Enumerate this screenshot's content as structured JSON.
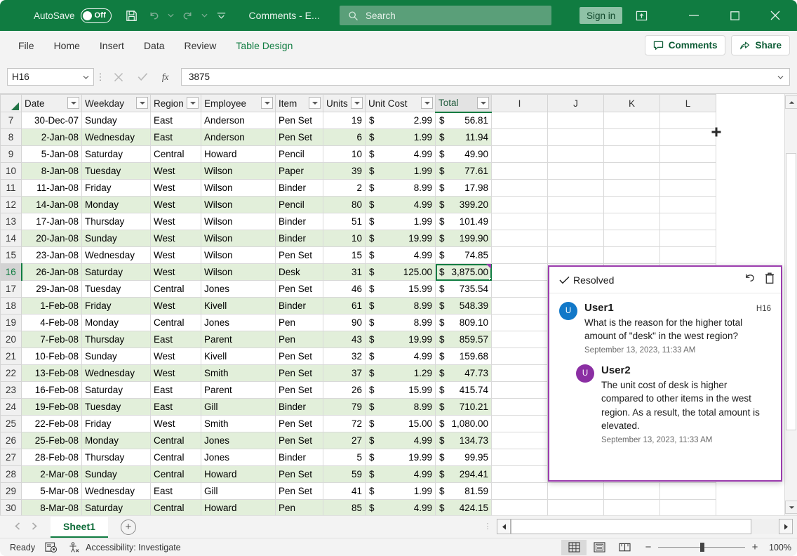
{
  "titlebar": {
    "autosave_label": "AutoSave",
    "autosave_state": "Off",
    "document_title": "Comments  -  E...",
    "sign_in": "Sign in",
    "icons": {
      "save": "save-icon",
      "undo": "undo-icon",
      "redo": "redo-icon",
      "customize": "customize-quick-access-toolbar-icon",
      "ribbon_display": "ribbon-display-options-icon",
      "minimize": "minimize-icon",
      "maximize": "maximize-icon",
      "close": "close-icon"
    }
  },
  "search": {
    "placeholder": "Search"
  },
  "ribbon": {
    "tabs": [
      {
        "label": "File",
        "active": false,
        "contextual": false
      },
      {
        "label": "Home",
        "active": false,
        "contextual": false
      },
      {
        "label": "Insert",
        "active": false,
        "contextual": false
      },
      {
        "label": "Data",
        "active": false,
        "contextual": false
      },
      {
        "label": "Review",
        "active": false,
        "contextual": false
      },
      {
        "label": "Table Design",
        "active": true,
        "contextual": true
      }
    ],
    "comments_button": "Comments",
    "share_button": "Share"
  },
  "formula_bar": {
    "name_box": "H16",
    "value": "3875",
    "cancel_icon": "cancel-icon",
    "enter_icon": "enter-icon",
    "fx_icon": "insert-function-icon",
    "expand_icon": "expand-formula-bar-icon"
  },
  "grid": {
    "column_letters": [
      "I",
      "J",
      "K",
      "L"
    ],
    "table_headers": [
      "Date",
      "Weekday",
      "Region",
      "Employee",
      "Item",
      "Units",
      "Unit Cost",
      "Total"
    ],
    "active_cell": "H16",
    "rows": [
      {
        "n": "7",
        "band": false,
        "date": "30-Dec-07",
        "weekday": "Sunday",
        "region": "East",
        "employee": "Anderson",
        "item": "Pen Set",
        "units": "19",
        "unit_cost": "2.99",
        "total": "56.81"
      },
      {
        "n": "8",
        "band": true,
        "date": "2-Jan-08",
        "weekday": "Wednesday",
        "region": "East",
        "employee": "Anderson",
        "item": "Pen Set",
        "units": "6",
        "unit_cost": "1.99",
        "total": "11.94"
      },
      {
        "n": "9",
        "band": false,
        "date": "5-Jan-08",
        "weekday": "Saturday",
        "region": "Central",
        "employee": "Howard",
        "item": "Pencil",
        "units": "10",
        "unit_cost": "4.99",
        "total": "49.90"
      },
      {
        "n": "10",
        "band": true,
        "date": "8-Jan-08",
        "weekday": "Tuesday",
        "region": "West",
        "employee": "Wilson",
        "item": "Paper",
        "units": "39",
        "unit_cost": "1.99",
        "total": "77.61"
      },
      {
        "n": "11",
        "band": false,
        "date": "11-Jan-08",
        "weekday": "Friday",
        "region": "West",
        "employee": "Wilson",
        "item": "Binder",
        "units": "2",
        "unit_cost": "8.99",
        "total": "17.98"
      },
      {
        "n": "12",
        "band": true,
        "date": "14-Jan-08",
        "weekday": "Monday",
        "region": "West",
        "employee": "Wilson",
        "item": "Pencil",
        "units": "80",
        "unit_cost": "4.99",
        "total": "399.20"
      },
      {
        "n": "13",
        "band": false,
        "date": "17-Jan-08",
        "weekday": "Thursday",
        "region": "West",
        "employee": "Wilson",
        "item": "Binder",
        "units": "51",
        "unit_cost": "1.99",
        "total": "101.49"
      },
      {
        "n": "14",
        "band": true,
        "date": "20-Jan-08",
        "weekday": "Sunday",
        "region": "West",
        "employee": "Wilson",
        "item": "Binder",
        "units": "10",
        "unit_cost": "19.99",
        "total": "199.90"
      },
      {
        "n": "15",
        "band": false,
        "date": "23-Jan-08",
        "weekday": "Wednesday",
        "region": "West",
        "employee": "Wilson",
        "item": "Pen Set",
        "units": "15",
        "unit_cost": "4.99",
        "total": "74.85"
      },
      {
        "n": "16",
        "band": true,
        "date": "26-Jan-08",
        "weekday": "Saturday",
        "region": "West",
        "employee": "Wilson",
        "item": "Desk",
        "units": "31",
        "unit_cost": "125.00",
        "total": "3,875.00",
        "selected": true
      },
      {
        "n": "17",
        "band": false,
        "date": "29-Jan-08",
        "weekday": "Tuesday",
        "region": "Central",
        "employee": "Jones",
        "item": "Pen Set",
        "units": "46",
        "unit_cost": "15.99",
        "total": "735.54"
      },
      {
        "n": "18",
        "band": true,
        "date": "1-Feb-08",
        "weekday": "Friday",
        "region": "West",
        "employee": "Kivell",
        "item": "Binder",
        "units": "61",
        "unit_cost": "8.99",
        "total": "548.39"
      },
      {
        "n": "19",
        "band": false,
        "date": "4-Feb-08",
        "weekday": "Monday",
        "region": "Central",
        "employee": "Jones",
        "item": "Pen",
        "units": "90",
        "unit_cost": "8.99",
        "total": "809.10"
      },
      {
        "n": "20",
        "band": true,
        "date": "7-Feb-08",
        "weekday": "Thursday",
        "region": "East",
        "employee": "Parent",
        "item": "Pen",
        "units": "43",
        "unit_cost": "19.99",
        "total": "859.57"
      },
      {
        "n": "21",
        "band": false,
        "date": "10-Feb-08",
        "weekday": "Sunday",
        "region": "West",
        "employee": "Kivell",
        "item": "Pen Set",
        "units": "32",
        "unit_cost": "4.99",
        "total": "159.68"
      },
      {
        "n": "22",
        "band": true,
        "date": "13-Feb-08",
        "weekday": "Wednesday",
        "region": "West",
        "employee": "Smith",
        "item": "Pen Set",
        "units": "37",
        "unit_cost": "1.29",
        "total": "47.73"
      },
      {
        "n": "23",
        "band": false,
        "date": "16-Feb-08",
        "weekday": "Saturday",
        "region": "East",
        "employee": "Parent",
        "item": "Pen Set",
        "units": "26",
        "unit_cost": "15.99",
        "total": "415.74"
      },
      {
        "n": "24",
        "band": true,
        "date": "19-Feb-08",
        "weekday": "Tuesday",
        "region": "East",
        "employee": "Gill",
        "item": "Binder",
        "units": "79",
        "unit_cost": "8.99",
        "total": "710.21"
      },
      {
        "n": "25",
        "band": false,
        "date": "22-Feb-08",
        "weekday": "Friday",
        "region": "West",
        "employee": "Smith",
        "item": "Pen Set",
        "units": "72",
        "unit_cost": "15.00",
        "total": "1,080.00"
      },
      {
        "n": "26",
        "band": true,
        "date": "25-Feb-08",
        "weekday": "Monday",
        "region": "Central",
        "employee": "Jones",
        "item": "Pen Set",
        "units": "27",
        "unit_cost": "4.99",
        "total": "134.73"
      },
      {
        "n": "27",
        "band": false,
        "date": "28-Feb-08",
        "weekday": "Thursday",
        "region": "Central",
        "employee": "Jones",
        "item": "Binder",
        "units": "5",
        "unit_cost": "19.99",
        "total": "99.95"
      },
      {
        "n": "28",
        "band": true,
        "date": "2-Mar-08",
        "weekday": "Sunday",
        "region": "Central",
        "employee": "Howard",
        "item": "Pen Set",
        "units": "59",
        "unit_cost": "4.99",
        "total": "294.41"
      },
      {
        "n": "29",
        "band": false,
        "date": "5-Mar-08",
        "weekday": "Wednesday",
        "region": "East",
        "employee": "Gill",
        "item": "Pen Set",
        "units": "41",
        "unit_cost": "1.99",
        "total": "81.59"
      },
      {
        "n": "30",
        "band": true,
        "date": "8-Mar-08",
        "weekday": "Saturday",
        "region": "Central",
        "employee": "Howard",
        "item": "Pen",
        "units": "85",
        "unit_cost": "4.99",
        "total": "424.15"
      }
    ]
  },
  "comment_card": {
    "resolved_label": "Resolved",
    "reopen_icon": "reopen-thread-icon",
    "delete_icon": "delete-thread-icon",
    "check_icon": "checkmark-icon",
    "accent_color": "#9b3cae",
    "comments": [
      {
        "author": "User1",
        "initial": "U",
        "avatar_color": "#1278c8",
        "cell_ref": "H16",
        "text": "What is the reason for the higher total amount of \"desk\"  in the west region?",
        "date": "September 13, 2023, 11:33 AM",
        "is_reply": false
      },
      {
        "author": "User2",
        "initial": "U",
        "avatar_color": "#8b2fa3",
        "cell_ref": "",
        "text": "The unit cost of desk is higher compared to other items in the west region. As a result, the total amount is elevated.",
        "date": "September 13, 2023, 11:33 AM",
        "is_reply": true
      }
    ]
  },
  "sheetbar": {
    "prev_icon": "previous-sheet-icon",
    "next_icon": "next-sheet-icon",
    "sheets": [
      {
        "name": "Sheet1",
        "active": true
      }
    ],
    "add_sheet_label": "+"
  },
  "statusbar": {
    "mode": "Ready",
    "macro_icon": "record-macro-icon",
    "accessibility_icon": "accessibility-icon",
    "accessibility": "Accessibility: Investigate",
    "views": [
      {
        "name": "normal-view",
        "active": true
      },
      {
        "name": "page-layout-view",
        "active": false
      },
      {
        "name": "page-break-preview",
        "active": false
      }
    ],
    "zoom_out": "−",
    "zoom_in": "+",
    "zoom_level": "100%"
  }
}
